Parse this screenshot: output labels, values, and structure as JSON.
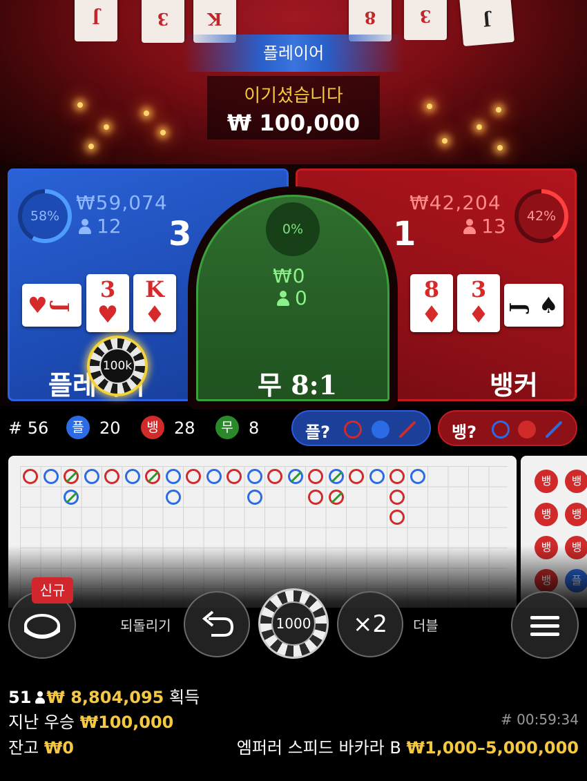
{
  "result": {
    "banner": "플레이어",
    "message": "이기셨습니다",
    "amount": "₩ 100,000"
  },
  "player": {
    "percent": "58%",
    "bet_total": "₩59,074",
    "bettors": "12",
    "score": "3",
    "cards": [
      {
        "rank": "J",
        "suit": "♥",
        "color": "red"
      },
      {
        "rank": "3",
        "suit": "♥",
        "color": "red"
      },
      {
        "rank": "K",
        "suit": "♦",
        "color": "red"
      }
    ],
    "label": "플레이어",
    "chip": "100k",
    "fill_fraction": 0.58
  },
  "tie": {
    "percent": "0%",
    "bet_total": "₩0",
    "bettors": "0",
    "label": "무 8:1"
  },
  "banker": {
    "percent": "42%",
    "bet_total": "₩42,204",
    "bettors": "13",
    "score": "1",
    "cards": [
      {
        "rank": "8",
        "suit": "♦",
        "color": "red"
      },
      {
        "rank": "3",
        "suit": "♦",
        "color": "red"
      },
      {
        "rank": "J",
        "suit": "♠",
        "color": "black"
      }
    ],
    "label": "뱅커",
    "fill_fraction": 0.42
  },
  "stats": {
    "round": "# 56",
    "player_badge": "플",
    "player_count": "20",
    "banker_badge": "뱅",
    "banker_count": "28",
    "tie_badge": "무",
    "tie_count": "8",
    "player_predict": "플?",
    "banker_predict": "뱅?"
  },
  "roadmap": {
    "columns": [
      [
        "B"
      ],
      [
        "P"
      ],
      [
        "B*",
        "P*"
      ],
      [
        "P"
      ],
      [
        "B"
      ],
      [
        "P"
      ],
      [
        "B*"
      ],
      [
        "P",
        "P"
      ],
      [
        "B"
      ],
      [
        "P"
      ],
      [
        "B"
      ],
      [
        "P",
        "P"
      ],
      [
        "B"
      ],
      [
        "P*"
      ],
      [
        "B",
        "B"
      ],
      [
        "P*",
        "B*"
      ],
      [
        "B"
      ],
      [
        "P"
      ],
      [
        "B",
        "B",
        "B"
      ],
      [
        "P"
      ]
    ],
    "side_badges": [
      "뱅",
      "뱅",
      "뱅",
      "뱅",
      "뱅",
      "뱅",
      "뱅",
      "플"
    ]
  },
  "controls": {
    "new_badge": "신규",
    "undo_label": "되돌리기",
    "chip_value": "1000",
    "double_symbol": "×2",
    "double_label": "더블"
  },
  "footer": {
    "winners_count": "51",
    "winners_amount": "₩ 8,804,095",
    "winners_suffix": "획득",
    "last_win_label": "지난 우승",
    "last_win_amount": "₩100,000",
    "round_timer": "# 00:59:34",
    "balance_label": "잔고",
    "balance_amount": "₩0",
    "table_name": "엠퍼러 스피드 바카라 B",
    "table_limits": "₩1,000–5,000,000"
  },
  "colors": {
    "player": "#2a62d6",
    "banker": "#b0141c",
    "tie": "#2f6e2f",
    "gold": "#f5c842"
  }
}
